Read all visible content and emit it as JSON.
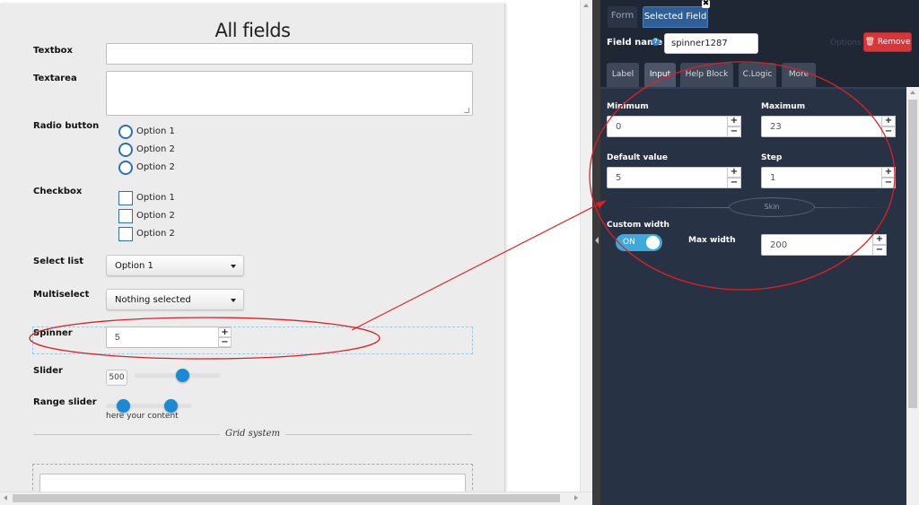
{
  "form": {
    "title": "All fields",
    "fields": {
      "textbox_label": "Textbox",
      "textarea_label": "Textarea",
      "radio_label": "Radio button",
      "radio_options": [
        "Option 1",
        "Option 2",
        "Option 2"
      ],
      "checkbox_label": "Checkbox",
      "checkbox_options": [
        "Option 1",
        "Option 2",
        "Option 2"
      ],
      "select_label": "Select list",
      "select_value": "Option 1",
      "multiselect_label": "Multiselect",
      "multiselect_value": "Nothing selected",
      "spinner_label": "Spinner",
      "spinner_value": "5",
      "slider_label": "Slider",
      "slider_value": "500",
      "slider_level": 0.55,
      "range_label": "Range slider",
      "range_low": 0.2,
      "range_high": 0.75,
      "range_hint": "here your content",
      "grid_label": "Grid system"
    },
    "spin_plus": "+",
    "spin_minus": "−"
  },
  "panel": {
    "tabs": [
      "Form",
      "Selected Field"
    ],
    "close_glyph": "✖",
    "field_name_label": "Field name",
    "help_glyph": "?",
    "field_name_value": "spinner1287",
    "options_link": "Options",
    "remove_label": "🗑 Remove",
    "subtabs": [
      "Label",
      "Input",
      "Help Block",
      "C.Logic",
      "More"
    ],
    "minimum_label": "Minimum",
    "minimum_value": "0",
    "maximum_label": "Maximum",
    "maximum_value": "23",
    "default_label": "Default value",
    "default_value": "5",
    "step_label": "Step",
    "step_value": "1",
    "skin_label": "Skin",
    "custom_width_label": "Custom width",
    "toggle_state": "ON",
    "max_width_label": "Max width",
    "max_width_value": "200"
  },
  "colors": {
    "accent_blue": "#2a72b5",
    "remove_red": "#d9363a",
    "annotation_red": "#e02020",
    "toggle_on": "#3fa8dc"
  }
}
